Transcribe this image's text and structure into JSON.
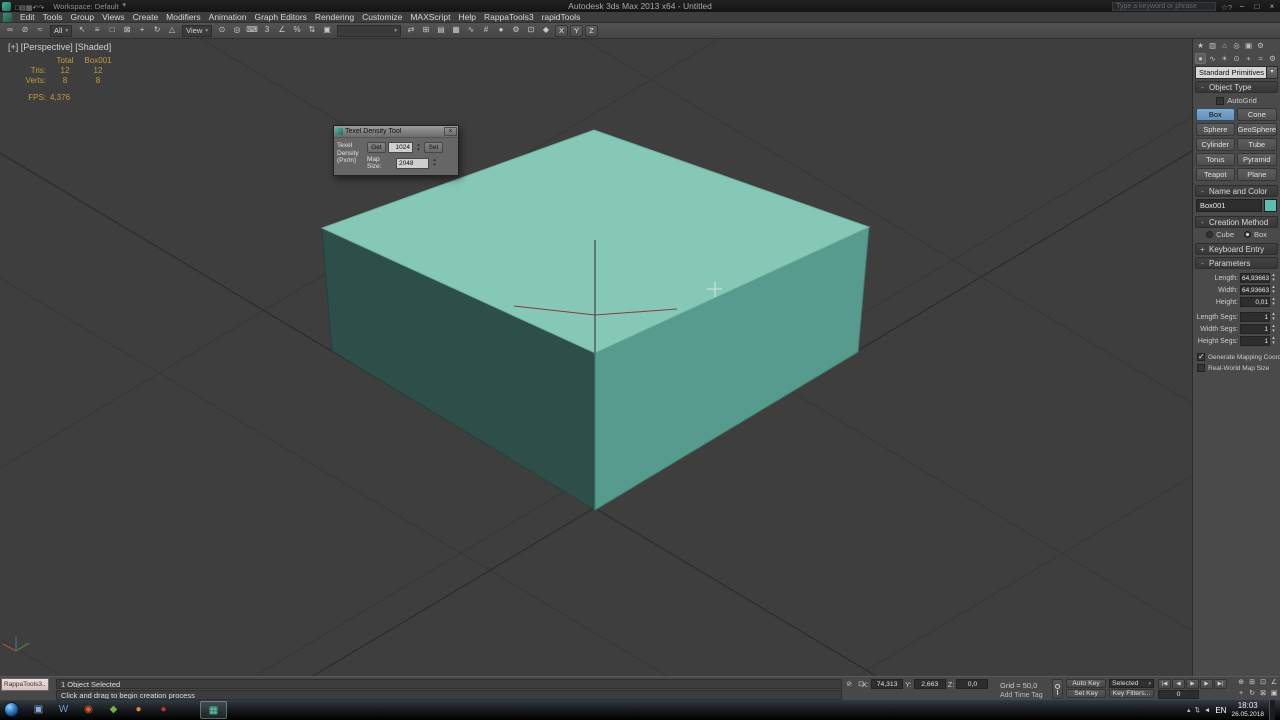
{
  "ui": {
    "spin_up": "▴",
    "spin_down": "▾",
    "dropdown_arrow": "▾"
  },
  "titlebar": {
    "app_title": "Autodesk 3ds Max 2013 x64 - Untitled",
    "workspace": "Workspace: Default",
    "search_placeholder": "Type a keyword or phrase",
    "quick_access": [
      {
        "glyph": "□",
        "name": "new-file-icon"
      },
      {
        "glyph": "▤",
        "name": "open-file-icon"
      },
      {
        "glyph": "▦",
        "name": "save-file-icon"
      },
      {
        "glyph": "↶",
        "name": "undo-icon"
      },
      {
        "glyph": "↷",
        "name": "redo-icon"
      }
    ],
    "right_icons": [
      {
        "glyph": "☆",
        "name": "favorites-icon"
      },
      {
        "glyph": "?",
        "name": "help-icon"
      }
    ],
    "window_buttons": {
      "minimize": "−",
      "maximize": "□",
      "close": "×"
    }
  },
  "menubar": {
    "items": [
      "Edit",
      "Tools",
      "Group",
      "Views",
      "Create",
      "Modifiers",
      "Animation",
      "Graph Editors",
      "Rendering",
      "Customize",
      "MAXScript",
      "Help",
      "RappaTools3",
      "rapidTools"
    ]
  },
  "toolbar": {
    "icons_a": [
      {
        "glyph": "∞",
        "name": "select-and-link-icon"
      },
      {
        "glyph": "⊘",
        "name": "unlink-selection-icon"
      },
      {
        "glyph": "≈",
        "name": "bind-to-space-warp-icon"
      }
    ],
    "selection_filter": "All",
    "icons_b": [
      {
        "glyph": "↖",
        "name": "select-object-icon"
      },
      {
        "glyph": "≡",
        "name": "select-by-name-icon"
      },
      {
        "glyph": "□",
        "name": "rectangular-selection-region-icon"
      },
      {
        "glyph": "⊠",
        "name": "window-crossing-toggle-icon"
      },
      {
        "glyph": "+",
        "name": "select-and-move-icon"
      },
      {
        "glyph": "↻",
        "name": "select-and-rotate-icon"
      },
      {
        "glyph": "△",
        "name": "select-and-scale-icon"
      }
    ],
    "coord_system": "View",
    "icons_c": [
      {
        "glyph": "⊙",
        "name": "use-pivot-point-center-icon"
      },
      {
        "glyph": "◎",
        "name": "select-and-manipulate-icon"
      },
      {
        "glyph": "⌨",
        "name": "keyboard-shortcut-override-icon"
      },
      {
        "glyph": "3",
        "name": "snaps-toggle-icon"
      },
      {
        "glyph": "∠",
        "name": "angle-snap-toggle-icon"
      },
      {
        "glyph": "%",
        "name": "percent-snap-toggle-icon"
      },
      {
        "glyph": "⇅",
        "name": "spinner-snap-toggle-icon"
      },
      {
        "glyph": "▣",
        "name": "edit-named-selection-sets-icon"
      }
    ],
    "named_selection": "",
    "icons_d": [
      {
        "glyph": "⇄",
        "name": "mirror-icon"
      },
      {
        "glyph": "⊞",
        "name": "align-icon"
      },
      {
        "glyph": "▤",
        "name": "layer-manager-icon"
      },
      {
        "glyph": "▦",
        "name": "ribbon-toggle-icon"
      },
      {
        "glyph": "∿",
        "name": "curve-editor-icon"
      },
      {
        "glyph": "#",
        "name": "schematic-view-icon"
      },
      {
        "glyph": "●",
        "name": "material-editor-icon"
      },
      {
        "glyph": "⚙",
        "name": "render-setup-icon"
      },
      {
        "glyph": "⊡",
        "name": "rendered-frame-window-icon"
      },
      {
        "glyph": "◆",
        "name": "render-production-icon"
      }
    ],
    "axis_buttons": [
      {
        "label": "X",
        "name": "x-axis-button"
      },
      {
        "label": "Y",
        "name": "y-axis-button"
      },
      {
        "label": "Z",
        "name": "z-axis-button"
      }
    ]
  },
  "viewport": {
    "label": "[+] [Perspective] [Shaded]",
    "stats": {
      "h1": "Total",
      "h2": "Box001",
      "tris_label": "Tris:",
      "tris_a": "12",
      "tris_b": "12",
      "verts_label": "Verts:",
      "verts_a": "8",
      "verts_b": "8",
      "fps_label": "FPS:",
      "fps_value": "4,376"
    },
    "box_colors": {
      "top": "#85c8b6",
      "right": "#569b8e",
      "left": "#2e4f49"
    }
  },
  "dialog": {
    "title": "Texel Density Tool",
    "close_glyph": "×",
    "density_label": "Texel Density (Px/m)",
    "get_button": "Get",
    "density_value": "1024",
    "set_button": "Set",
    "map_size_label": "Map Size:",
    "map_size_value": "2048"
  },
  "command_panel": {
    "tabs": [
      {
        "glyph": "★",
        "name": "tab-create"
      },
      {
        "glyph": "▧",
        "name": "tab-modify"
      },
      {
        "glyph": "⌂",
        "name": "tab-hierarchy"
      },
      {
        "glyph": "◎",
        "name": "tab-motion"
      },
      {
        "glyph": "▣",
        "name": "tab-display"
      },
      {
        "glyph": "⚙",
        "name": "tab-utilities"
      }
    ],
    "categories": [
      {
        "glyph": "●",
        "name": "category-geometry",
        "cls": "active"
      },
      {
        "glyph": "∿",
        "name": "category-shapes"
      },
      {
        "glyph": "☀",
        "name": "category-lights"
      },
      {
        "glyph": "⊙",
        "name": "category-cameras"
      },
      {
        "glyph": "+",
        "name": "category-helpers"
      },
      {
        "glyph": "≈",
        "name": "category-space-warps"
      },
      {
        "glyph": "⚙",
        "name": "category-systems"
      }
    ],
    "category_dropdown": "Standard Primitives",
    "object_type": {
      "title": "Object Type",
      "sign": "-",
      "autogrid": "AutoGrid",
      "buttons": [
        {
          "label": "Box",
          "name": "primitive-box-button",
          "cls": "active"
        },
        {
          "label": "Cone",
          "name": "primitive-cone-button"
        },
        {
          "label": "Sphere",
          "name": "primitive-sphere-button"
        },
        {
          "label": "GeoSphere",
          "name": "primitive-geosphere-button"
        },
        {
          "label": "Cylinder",
          "name": "primitive-cylinder-button"
        },
        {
          "label": "Tube",
          "name": "primitive-tube-button"
        },
        {
          "label": "Torus",
          "name": "primitive-torus-button"
        },
        {
          "label": "Pyramid",
          "name": "primitive-pyramid-button"
        },
        {
          "label": "Teapot",
          "name": "primitive-teapot-button"
        },
        {
          "label": "Plane",
          "name": "primitive-plane-button"
        }
      ]
    },
    "name_color": {
      "title": "Name and Color",
      "sign": "-",
      "name": "Box001",
      "swatch": "#5bbfae"
    },
    "creation_method": {
      "title": "Creation Method",
      "sign": "-",
      "options": [
        {
          "label": "Cube",
          "name": "creation-method-cube-radio"
        },
        {
          "label": "Box",
          "name": "creation-method-box-radio",
          "cls": "checked"
        }
      ]
    },
    "keyboard_entry": {
      "title": "Keyboard Entry",
      "sign": "+"
    },
    "parameters": {
      "title": "Parameters",
      "sign": "-",
      "fields": [
        {
          "label": "Length:",
          "value": "64,93663",
          "name": "length-field"
        },
        {
          "label": "Width:",
          "value": "64,93663",
          "name": "width-field"
        },
        {
          "label": "Height:",
          "value": "0,01",
          "name": "height-field"
        },
        {
          "label": "Length Segs:",
          "value": "1",
          "name": "length-segs-field"
        },
        {
          "label": "Width Segs:",
          "value": "1",
          "name": "width-segs-field"
        },
        {
          "label": "Height Segs:",
          "value": "1",
          "name": "height-segs-field"
        }
      ],
      "checkboxes": [
        {
          "label": "Generate Mapping Coords.",
          "name": "generate-mapping-coords-checkbox",
          "cls": "checked"
        },
        {
          "label": "Real-World Map Size",
          "name": "real-world-map-size-checkbox"
        }
      ]
    }
  },
  "status_bar": {
    "mini_window_title": "RappaTools3..",
    "status_line": "1 Object Selected",
    "prompt_line": "Click and drag to begin creation process",
    "icons": [
      {
        "glyph": "⊘",
        "name": "isolate-selection-toggle-icon"
      },
      {
        "glyph": "⊡",
        "name": "selection-lock-toggle-icon"
      }
    ],
    "coords": [
      {
        "label": "X:",
        "value": "74,313",
        "name": "x-coordinate-field"
      },
      {
        "label": "Y:",
        "value": "2,663",
        "name": "y-coordinate-field"
      },
      {
        "label": "Z:",
        "value": "0,0",
        "name": "z-coordinate-field"
      }
    ],
    "grid_label": "Grid = 50,0",
    "time_tag": "Add Time Tag",
    "auto_key": "Auto Key",
    "selection_set": "Selected",
    "set_key": "Set Key",
    "key_filters": "Key Filters...",
    "frame": "0",
    "transport": [
      {
        "glyph": "|◀",
        "name": "goto-start-button"
      },
      {
        "glyph": "◀",
        "name": "previous-frame-button"
      },
      {
        "glyph": "▶",
        "name": "play-button"
      },
      {
        "glyph": "▶",
        "name": "next-frame-button"
      },
      {
        "glyph": "▶|",
        "name": "goto-end-button"
      }
    ],
    "nav_icons": [
      {
        "glyph": "⊕",
        "name": "zoom-icon"
      },
      {
        "glyph": "⊞",
        "name": "zoom-all-icon"
      },
      {
        "glyph": "⊡",
        "name": "zoom-extents-icon"
      },
      {
        "glyph": "∠",
        "name": "field-of-view-icon"
      },
      {
        "glyph": "+",
        "name": "pan-icon"
      },
      {
        "glyph": "↻",
        "name": "orbit-icon"
      },
      {
        "glyph": "⊠",
        "name": "zoom-region-icon"
      },
      {
        "glyph": "▣",
        "name": "maximize-viewport-toggle-icon"
      }
    ]
  },
  "taskbar": {
    "apps": [
      {
        "glyph": "▣",
        "name": "taskbar-app-explorer",
        "color": "#88aee0"
      },
      {
        "glyph": "W",
        "name": "taskbar-app-word",
        "color": "#6a9bd8"
      },
      {
        "glyph": "◉",
        "name": "taskbar-app-browser",
        "color": "#e55b2d"
      },
      {
        "glyph": "◆",
        "name": "taskbar-app-green",
        "color": "#74b43c"
      },
      {
        "glyph": "●",
        "name": "taskbar-app-firefox",
        "color": "#e08a30"
      },
      {
        "glyph": "●",
        "name": "taskbar-app-red",
        "color": "#c83232"
      }
    ],
    "active_app": {
      "glyph": "▦"
    },
    "tray_icons": [
      {
        "glyph": "▴",
        "name": "tray-show-hidden-icon"
      },
      {
        "glyph": "⇅",
        "name": "tray-network-icon"
      },
      {
        "glyph": "◄",
        "name": "tray-volume-icon"
      }
    ],
    "language": "EN",
    "time": "18:03",
    "date": "26.05.2018"
  }
}
